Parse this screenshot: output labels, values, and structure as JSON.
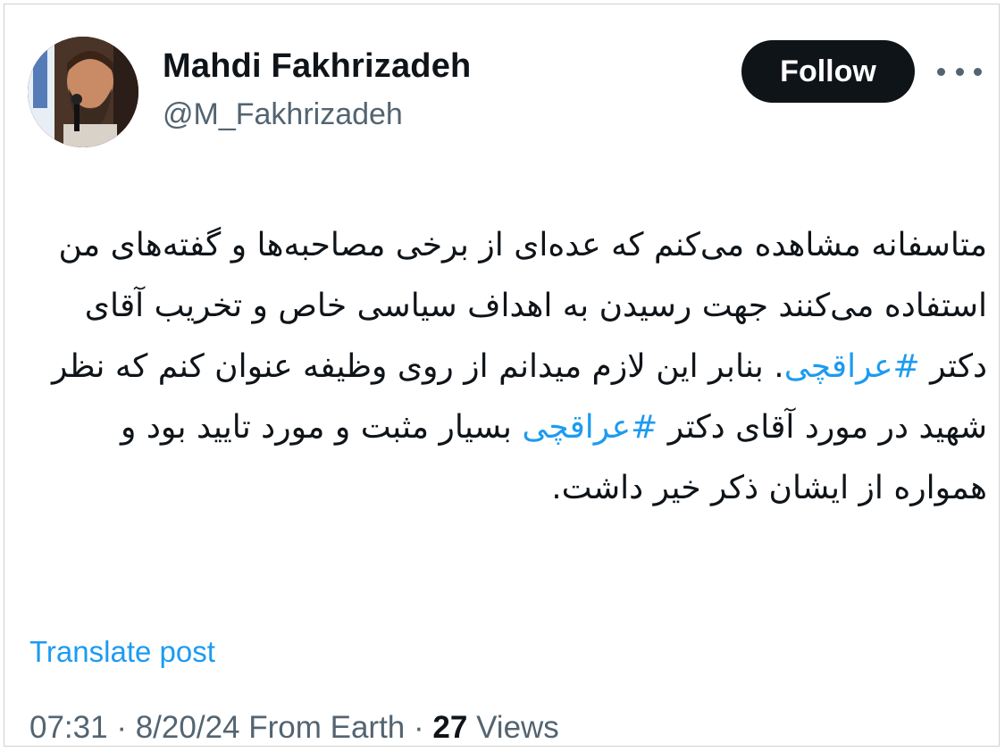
{
  "author": {
    "display_name": "Mahdi Fakhrizadeh",
    "handle": "@M_Fakhrizadeh"
  },
  "actions": {
    "follow_label": "Follow",
    "more_icon": "more-horizontal-icon"
  },
  "tweet": {
    "segments": [
      {
        "text": "متاسفانه مشاهده می‌کنم که عده‌ای از برخی مصاحبه‌ها و گفته‌های من استفاده می‌کنند جهت رسیدن به اهداف سیاسی خاص و تخریب آقای دکتر ",
        "hashtag": false
      },
      {
        "text": "#عراقچی",
        "hashtag": true
      },
      {
        "text": ". بنابر این لازم میدانم از روی وظیفه عنوان کنم که نظر شهید در مورد آقای دکتر ",
        "hashtag": false
      },
      {
        "text": "#عراقچی",
        "hashtag": true
      },
      {
        "text": " بسیار مثبت و مورد تایید بود و همواره از ایشان ذکر خیر داشت.",
        "hashtag": false
      }
    ],
    "translate_label": "Translate post"
  },
  "meta": {
    "time": "07:31",
    "separator": "·",
    "date": "8/20/24",
    "source": "From Earth",
    "views_count": "27",
    "views_label": "Views"
  },
  "colors": {
    "link": "#1d9bf0",
    "text_primary": "#0f1419",
    "text_secondary": "#536471",
    "button_bg": "#0f1419"
  }
}
